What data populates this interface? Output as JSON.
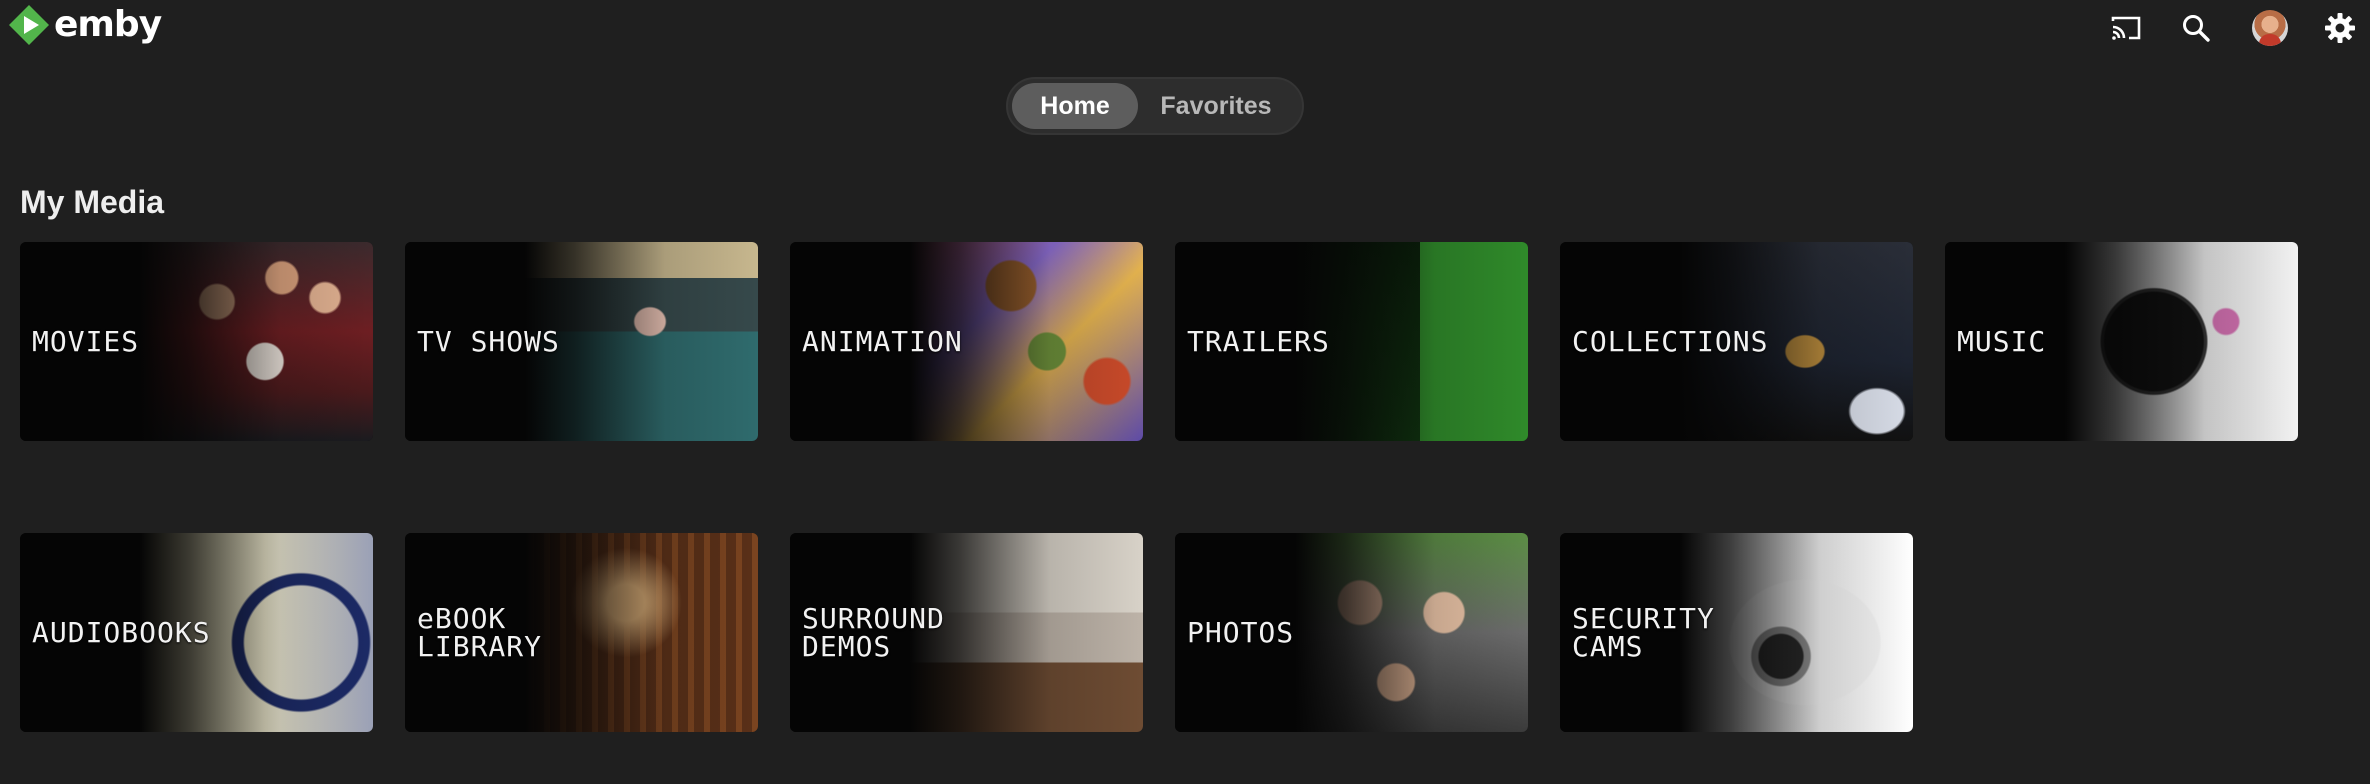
{
  "app": {
    "logo_text": "emby",
    "brand_color": "#52b54b"
  },
  "header": {
    "icons": [
      "cast-icon",
      "search-icon",
      "user-avatar",
      "gear-icon"
    ]
  },
  "tabs": [
    {
      "label": "Home",
      "active": true
    },
    {
      "label": "Favorites",
      "active": false
    }
  ],
  "section": {
    "title": "My Media"
  },
  "libraries": [
    {
      "label": "MOVIES"
    },
    {
      "label": "TV SHOWS"
    },
    {
      "label": "ANIMATION"
    },
    {
      "label": "TRAILERS"
    },
    {
      "label": "COLLECTIONS"
    },
    {
      "label": "MUSIC"
    },
    {
      "label": "AUDIOBOOKS"
    },
    {
      "label": "eBOOK\nLIBRARY"
    },
    {
      "label": "SURROUND\nDEMOS"
    },
    {
      "label": "PHOTOS"
    },
    {
      "label": "SECURITY\nCAMS"
    }
  ]
}
